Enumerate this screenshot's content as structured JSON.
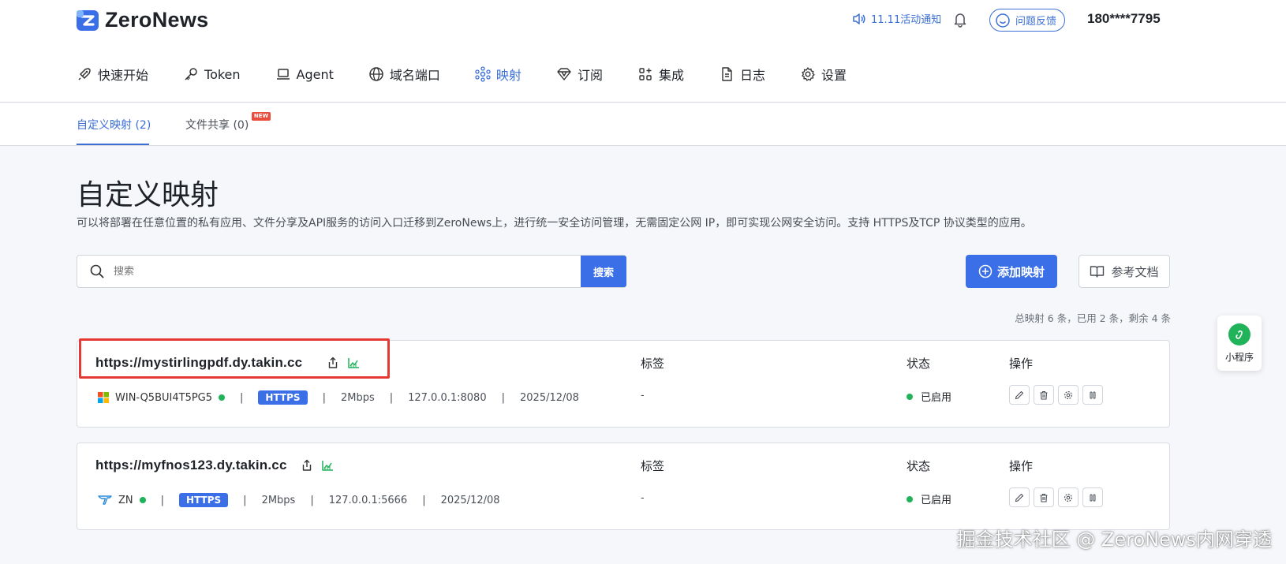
{
  "brand": {
    "name": "ZeroNews",
    "accent": "#3b6fe8",
    "success": "#21b35a",
    "danger": "#e53935"
  },
  "header": {
    "notice": "11.11活动通知",
    "feedback": "问题反馈",
    "user": "180****7795"
  },
  "nav": [
    {
      "label": "快速开始",
      "icon": "rocket-icon"
    },
    {
      "label": "Token",
      "icon": "key-icon"
    },
    {
      "label": "Agent",
      "icon": "laptop-icon"
    },
    {
      "label": "域名端口",
      "icon": "globe-icon"
    },
    {
      "label": "映射",
      "icon": "mapping-icon",
      "active": true
    },
    {
      "label": "订阅",
      "icon": "diamond-icon"
    },
    {
      "label": "集成",
      "icon": "grid-plus-icon"
    },
    {
      "label": "日志",
      "icon": "document-icon"
    },
    {
      "label": "设置",
      "icon": "gear-icon"
    }
  ],
  "subtabs": {
    "custom": "自定义映射 (2)",
    "share": "文件共享 (0)",
    "new_badge": "NEW"
  },
  "page": {
    "title": "自定义映射",
    "description": "可以将部署在任意位置的私有应用、文件分享及API服务的访问入口迁移到ZeroNews上，进行统一安全访问管理，无需固定公网 IP，即可实现公网安全访问。支持 HTTPS及TCP 协议类型的应用。"
  },
  "search": {
    "placeholder": "搜索",
    "button": "搜索"
  },
  "actions": {
    "add": "添加映射",
    "docs": "参考文档"
  },
  "summary": "总映射 6 条，已用 2 条，剩余 4 条",
  "columns": {
    "tags": "标签",
    "status": "状态",
    "ops": "操作"
  },
  "mappings": [
    {
      "url": "https://mystirlingpdf.dy.takin.cc",
      "device": "WIN-Q5BUI4T5PG5",
      "protocol": "HTTPS",
      "bandwidth": "2Mbps",
      "target": "127.0.0.1:8080",
      "date": "2025/12/08",
      "tags": "-",
      "status": "已启用"
    },
    {
      "url": "https://myfnos123.dy.takin.cc",
      "device": "ZN",
      "protocol": "HTTPS",
      "bandwidth": "2Mbps",
      "target": "127.0.0.1:5666",
      "date": "2025/12/08",
      "tags": "-",
      "status": "已启用"
    }
  ],
  "mini_program": "小程序",
  "watermark": "掘金技术社区 @ ZeroNews内网穿透"
}
